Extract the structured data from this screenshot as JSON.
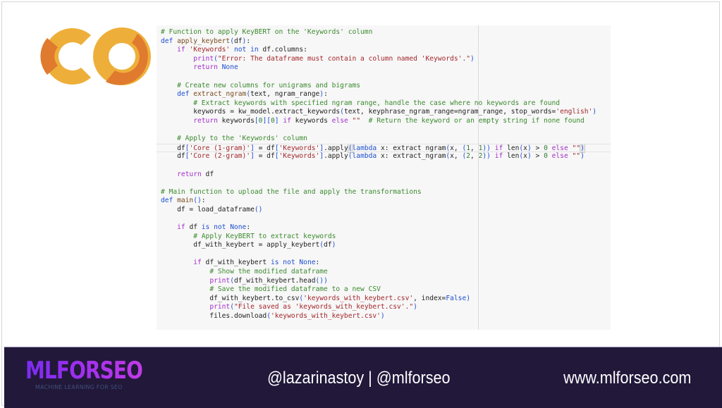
{
  "slide": {
    "logo": {
      "name": "colab-logo",
      "colors": {
        "light": "#EEAF3A",
        "dark": "#DF7A2E"
      }
    },
    "code_cell": {
      "lines": [
        [
          [
            "c-com",
            "# Function to apply KeyBERT on the 'Keywords' column"
          ]
        ],
        [
          [
            "c-kw",
            "def "
          ],
          [
            "c-fn",
            "apply_keybert"
          ],
          [
            "c-br",
            "("
          ],
          [
            "",
            "df"
          ],
          [
            "c-br",
            ")"
          ],
          [
            "",
            ":"
          ]
        ],
        [
          [
            "",
            "    "
          ],
          [
            "c-ctl",
            "if "
          ],
          [
            "c-str",
            "'Keywords'"
          ],
          [
            "c-kw",
            " not in "
          ],
          [
            "",
            "df.columns:"
          ]
        ],
        [
          [
            "",
            "        "
          ],
          [
            "c-ctl",
            "print"
          ],
          [
            "c-br",
            "("
          ],
          [
            "c-str",
            "\"Error: The dataframe must contain a column named 'Keywords'.\""
          ],
          [
            "c-br",
            ")"
          ]
        ],
        [
          [
            "",
            "        "
          ],
          [
            "c-ctl",
            "return "
          ],
          [
            "c-kw",
            "None"
          ]
        ],
        [
          [
            "",
            ""
          ]
        ],
        [
          [
            "",
            "    "
          ],
          [
            "c-com",
            "# Create new columns for unigrams and bigrams"
          ]
        ],
        [
          [
            "",
            "    "
          ],
          [
            "c-kw",
            "def "
          ],
          [
            "c-fn",
            "extract_ngram"
          ],
          [
            "c-br",
            "("
          ],
          [
            "",
            "text, ngram_range"
          ],
          [
            "c-br",
            ")"
          ],
          [
            "",
            ":"
          ]
        ],
        [
          [
            "",
            "        "
          ],
          [
            "c-com",
            "# Extract keywords with specified ngram range, handle the case where no keywords are found"
          ]
        ],
        [
          [
            "",
            "        keywords = kw_model.extract_keywords"
          ],
          [
            "c-br",
            "("
          ],
          [
            "",
            "text, keyphrase_ngram_range=ngram_range, stop_words="
          ],
          [
            "c-str",
            "'english'"
          ],
          [
            "c-br",
            ")"
          ]
        ],
        [
          [
            "",
            "        "
          ],
          [
            "c-ctl",
            "return "
          ],
          [
            "",
            "keywords"
          ],
          [
            "c-br",
            "["
          ],
          [
            "c-num",
            "0"
          ],
          [
            "c-br",
            "]["
          ],
          [
            "c-num",
            "0"
          ],
          [
            "c-br",
            "]"
          ],
          [
            "c-ctl",
            " if "
          ],
          [
            "",
            "keywords"
          ],
          [
            "c-ctl",
            " else "
          ],
          [
            "c-str",
            "\"\""
          ],
          [
            "",
            "  "
          ],
          [
            "c-com",
            "# Return the keyword or an empty string if none found"
          ]
        ],
        [
          [
            "",
            ""
          ]
        ],
        [
          [
            "",
            "    "
          ],
          [
            "c-com",
            "# Apply to the 'Keywords' column"
          ]
        ],
        [
          [
            "",
            "    df"
          ],
          [
            "c-br",
            "["
          ],
          [
            "c-str",
            "'Core (1-gram)'"
          ],
          [
            "c-br",
            "]"
          ],
          [
            "",
            " = df"
          ],
          [
            "c-br",
            "["
          ],
          [
            "c-str",
            "'Keywords'"
          ],
          [
            "c-br",
            "]"
          ],
          [
            "",
            ".apply"
          ],
          [
            "c-br c-sel",
            "("
          ],
          [
            "c-kw",
            "lambda "
          ],
          [
            "",
            "x: extract_ngram"
          ],
          [
            "c-br",
            "("
          ],
          [
            "",
            "x, "
          ],
          [
            "c-br",
            "("
          ],
          [
            "c-num",
            "1"
          ],
          [
            "",
            ", "
          ],
          [
            "c-num",
            "1"
          ],
          [
            "c-br",
            "))"
          ],
          [
            "c-ctl",
            " if "
          ],
          [
            "",
            "len"
          ],
          [
            "c-br",
            "("
          ],
          [
            "",
            "x"
          ],
          [
            "c-br",
            ")"
          ],
          [
            "",
            " > "
          ],
          [
            "c-num",
            "0"
          ],
          [
            "c-ctl",
            " else "
          ],
          [
            "c-str",
            "\"\""
          ],
          [
            "c-br c-sel",
            ")"
          ]
        ],
        [
          [
            "",
            "    df"
          ],
          [
            "c-br",
            "["
          ],
          [
            "c-str",
            "'Core (2-gram)'"
          ],
          [
            "c-br",
            "]"
          ],
          [
            "",
            " = df"
          ],
          [
            "c-br",
            "["
          ],
          [
            "c-str",
            "'Keywords'"
          ],
          [
            "c-br",
            "]"
          ],
          [
            "",
            ".apply"
          ],
          [
            "c-br",
            "("
          ],
          [
            "c-kw",
            "lambda "
          ],
          [
            "",
            "x: extract_ngram"
          ],
          [
            "c-br",
            "("
          ],
          [
            "",
            "x, "
          ],
          [
            "c-br",
            "("
          ],
          [
            "c-num",
            "2"
          ],
          [
            "",
            ", "
          ],
          [
            "c-num",
            "2"
          ],
          [
            "c-br",
            "))"
          ],
          [
            "c-ctl",
            " if "
          ],
          [
            "",
            "len"
          ],
          [
            "c-br",
            "("
          ],
          [
            "",
            "x"
          ],
          [
            "c-br",
            ")"
          ],
          [
            "",
            " > "
          ],
          [
            "c-num",
            "0"
          ],
          [
            "c-ctl",
            " else "
          ],
          [
            "c-str",
            "\"\""
          ],
          [
            "c-br",
            ")"
          ]
        ],
        [
          [
            "",
            ""
          ]
        ],
        [
          [
            "",
            "    "
          ],
          [
            "c-ctl",
            "return "
          ],
          [
            "",
            "df"
          ]
        ],
        [
          [
            "",
            ""
          ]
        ],
        [
          [
            "c-com",
            "# Main function to upload the file and apply the transformations"
          ]
        ],
        [
          [
            "c-kw",
            "def "
          ],
          [
            "c-fn",
            "main"
          ],
          [
            "c-br",
            "()"
          ],
          [
            "",
            ":"
          ]
        ],
        [
          [
            "",
            "    df = load_dataframe"
          ],
          [
            "c-br",
            "()"
          ]
        ],
        [
          [
            "",
            ""
          ]
        ],
        [
          [
            "",
            "    "
          ],
          [
            "c-ctl",
            "if "
          ],
          [
            "",
            "df"
          ],
          [
            "c-kw",
            " is not None"
          ],
          [
            "",
            ":"
          ]
        ],
        [
          [
            "",
            "        "
          ],
          [
            "c-com",
            "# Apply KeyBERT to extract keywords"
          ]
        ],
        [
          [
            "",
            "        df_with_keybert = apply_keybert"
          ],
          [
            "c-br",
            "("
          ],
          [
            "",
            "df"
          ],
          [
            "c-br",
            ")"
          ]
        ],
        [
          [
            "",
            ""
          ]
        ],
        [
          [
            "",
            "        "
          ],
          [
            "c-ctl",
            "if "
          ],
          [
            "",
            "df_with_keybert"
          ],
          [
            "c-kw",
            " is not None"
          ],
          [
            "",
            ":"
          ]
        ],
        [
          [
            "",
            "            "
          ],
          [
            "c-com",
            "# Show the modified dataframe"
          ]
        ],
        [
          [
            "",
            "            "
          ],
          [
            "c-ctl",
            "print"
          ],
          [
            "c-br",
            "("
          ],
          [
            "",
            "df_with_keybert.head"
          ],
          [
            "c-br",
            "())"
          ]
        ],
        [
          [
            "",
            "            "
          ],
          [
            "c-com",
            "# Save the modified dataframe to a new CSV"
          ]
        ],
        [
          [
            "",
            "            df_with_keybert.to_csv"
          ],
          [
            "c-br",
            "("
          ],
          [
            "c-str",
            "'keywords_with_keybert.csv'"
          ],
          [
            "",
            ", index="
          ],
          [
            "c-kw",
            "False"
          ],
          [
            "c-br",
            ")"
          ]
        ],
        [
          [
            "",
            "            "
          ],
          [
            "c-ctl",
            "print"
          ],
          [
            "c-br",
            "("
          ],
          [
            "c-str",
            "\"File saved as 'keywords_with_keybert.csv'.\""
          ],
          [
            "c-br",
            ")"
          ]
        ],
        [
          [
            "",
            "            files.download"
          ],
          [
            "c-br",
            "("
          ],
          [
            "c-str",
            "'keywords_with_keybert.csv'"
          ],
          [
            "c-br",
            ")"
          ]
        ]
      ],
      "active_line_index": 13
    }
  },
  "footer": {
    "brand_name": "MLFORSEO",
    "brand_tagline": "MACHINE LEARNING FOR SEO",
    "handles": "@lazarinastoy | @mlforseo",
    "website": "www.mlforseo.com",
    "background_color": "#22183A"
  }
}
